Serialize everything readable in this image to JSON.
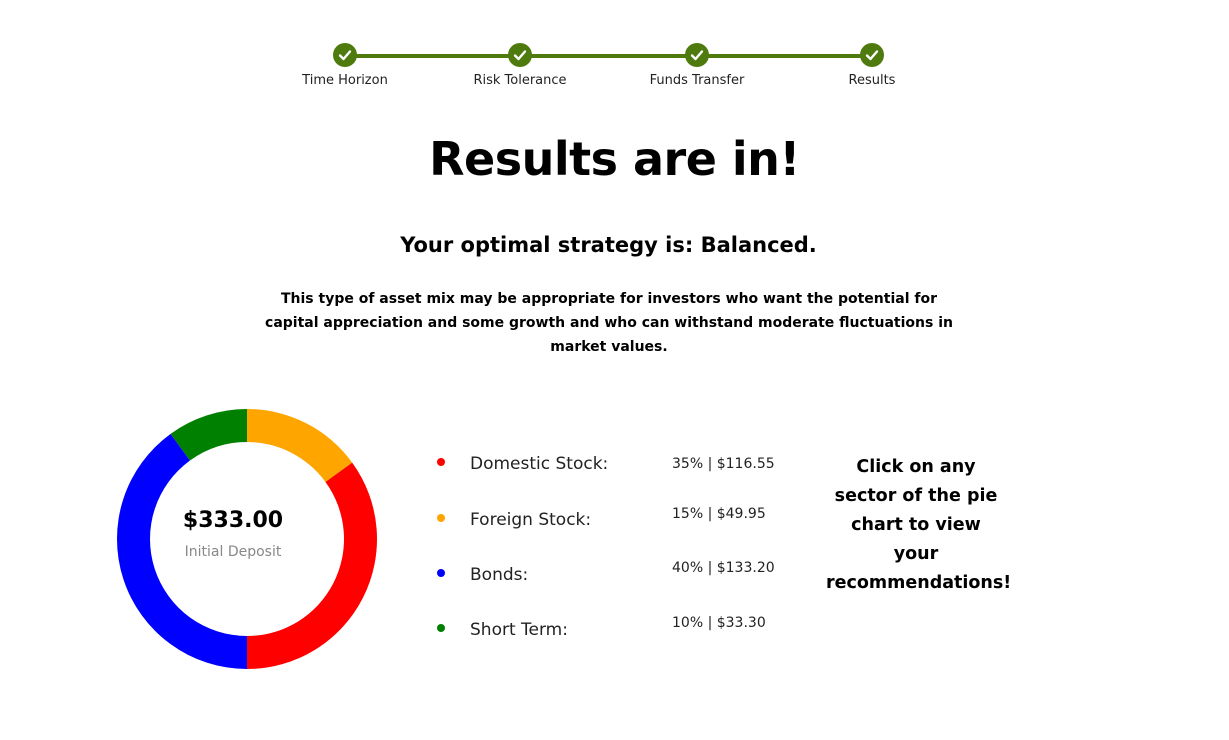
{
  "steps": [
    {
      "label": "Time Horizon",
      "complete": true
    },
    {
      "label": "Risk Tolerance",
      "complete": true
    },
    {
      "label": "Funds Transfer",
      "complete": true
    },
    {
      "label": "Results",
      "complete": true
    }
  ],
  "title": "Results are in!",
  "subtitle": "Your optimal strategy is: Balanced.",
  "description": "This type of asset mix may be appropriate for investors who want the potential for capital appreciation and some growth and who can withstand moderate fluctuations in market values.",
  "deposit": {
    "amount": "$333.00",
    "label": "Initial Deposit"
  },
  "allocations": [
    {
      "name": "Domestic Stock:",
      "value_text": "35% | $116.55",
      "percent": 35,
      "color": "#ff0000"
    },
    {
      "name": "Foreign Stock:",
      "value_text": "15% | $49.95",
      "percent": 15,
      "color": "#ffa500"
    },
    {
      "name": "Bonds:",
      "value_text": "40% | $133.20",
      "percent": 40,
      "color": "#0000ff"
    },
    {
      "name": "Short Term:",
      "value_text": "10% | $33.30",
      "percent": 10,
      "color": "#008000"
    }
  ],
  "hint": "Click on any sector of the pie chart to view your recommendations!"
}
